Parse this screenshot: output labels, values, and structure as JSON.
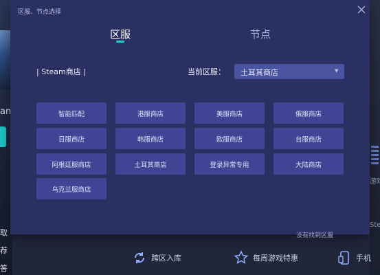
{
  "background": {
    "left_letters": [
      "an",
      "取",
      "荐",
      "答"
    ],
    "right_labels": [
      "游戏",
      "Stean"
    ],
    "bottom_items": [
      {
        "label": "跨区入库",
        "icon": "sync-icon"
      },
      {
        "label": "每周游戏特惠",
        "icon": "star-icon"
      },
      {
        "label": "手机",
        "icon": "phone-icon"
      }
    ]
  },
  "dialog": {
    "title": "区服、节点选择",
    "tabs": [
      {
        "label": "区服",
        "active": true
      },
      {
        "label": "节点",
        "active": false
      }
    ],
    "store_label": "| Steam商店 |",
    "current_region_label": "当前区服：",
    "current_region_value": "土耳其商店",
    "region_buttons": [
      "智能匹配",
      "港服商店",
      "美服商店",
      "俄服商店",
      "日服商店",
      "韩服商店",
      "欧服商店",
      "台服商店",
      "阿根廷服商店",
      "土耳其商店",
      "登录异常专用",
      "大陆商店",
      "乌克兰服商店"
    ],
    "not_found_link": "没有找到区服"
  },
  "colors": {
    "dialog_bg": "#2b3062",
    "button_bg": "#3f4594",
    "select_bg": "#4a53a0",
    "accent": "#25d3cf"
  }
}
